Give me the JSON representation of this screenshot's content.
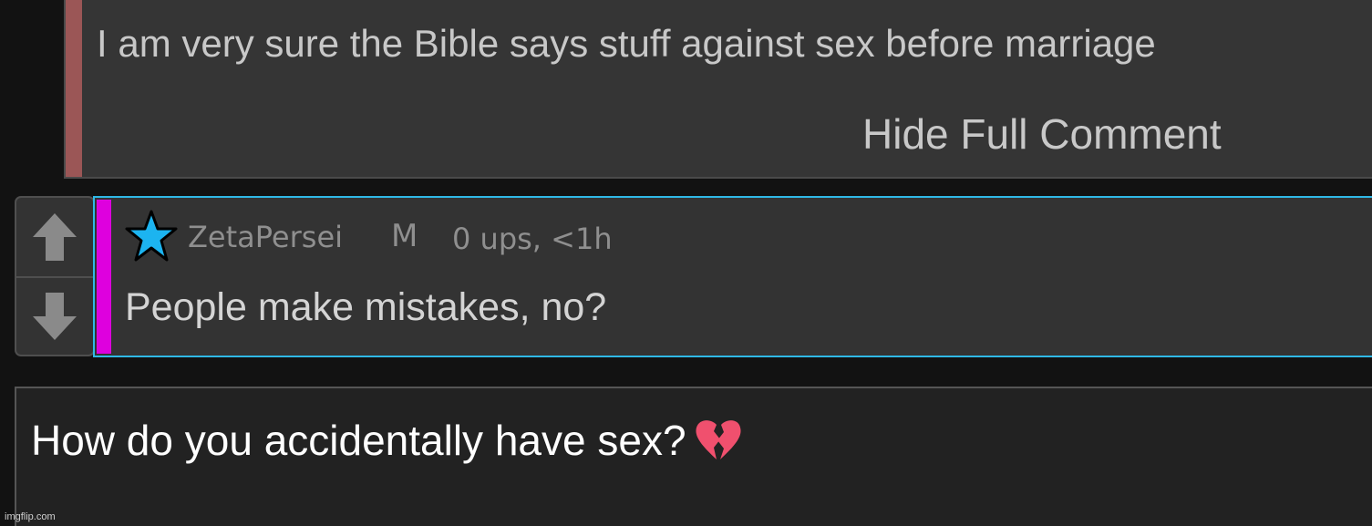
{
  "parent_comment": {
    "text": "I am very sure the Bible says stuff against sex before marriage",
    "hide_link": "Hide Full Comment",
    "stripe_color": "#9b5656"
  },
  "vote": {
    "up_icon": "arrow-up-icon",
    "down_icon": "arrow-down-icon"
  },
  "reply_comment": {
    "badge_icon": "star-icon",
    "badge_color": "#1cb4f0",
    "username": "ZetaPersei",
    "gender": "M",
    "meta": "0 ups, <1h",
    "text": "People make mistakes, no?",
    "stripe_color": "#de00de",
    "border_color": "#2fb8e6"
  },
  "compose": {
    "text": "How do you accidentally have sex?",
    "emoji_icon": "broken-heart-icon"
  },
  "watermark": "imgflip.com"
}
